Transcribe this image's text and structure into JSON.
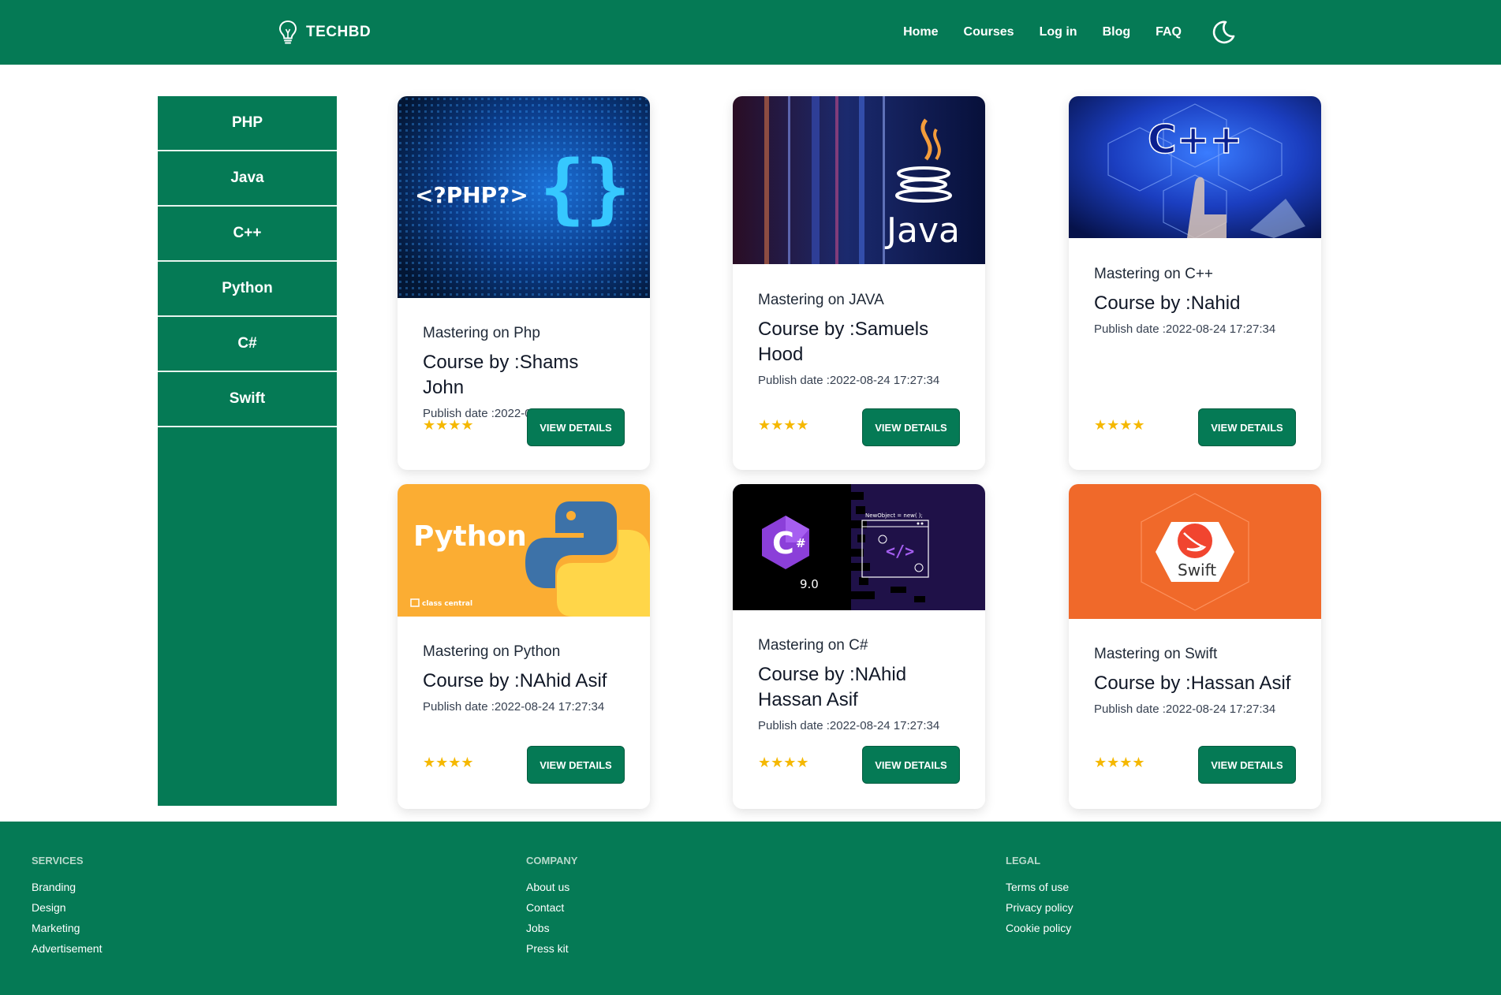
{
  "header": {
    "brand": "TECHBD",
    "nav": [
      "Home",
      "Courses",
      "Log in",
      "Blog",
      "FAQ"
    ]
  },
  "sidebar": {
    "items": [
      {
        "label": "PHP"
      },
      {
        "label": "Java"
      },
      {
        "label": "C++"
      },
      {
        "label": "Python"
      },
      {
        "label": "C#"
      },
      {
        "label": "Swift"
      }
    ]
  },
  "courses": [
    {
      "subtitle": "Mastering on Php",
      "title": "Course by :Shams John",
      "date": "Publish date :2022-08-24 17:27:34",
      "button": "VIEW DETAILS",
      "rating": 4,
      "stars": "★★★★",
      "image_text": "<?PHP?>"
    },
    {
      "subtitle": "Mastering on JAVA",
      "title": "Course by :Samuels Hood",
      "date": "Publish date :2022-08-24 17:27:34",
      "button": "VIEW DETAILS",
      "rating": 4,
      "stars": "★★★★",
      "image_text": "Java"
    },
    {
      "subtitle": "Mastering on C++",
      "title": "Course by :Nahid",
      "date": "Publish date :2022-08-24 17:27:34",
      "button": "VIEW DETAILS",
      "rating": 4,
      "stars": "★★★★",
      "image_text": "C++"
    },
    {
      "subtitle": "Mastering on Python",
      "title": "Course by :NAhid Asif",
      "date": "Publish date :2022-08-24 17:27:34",
      "button": "VIEW DETAILS",
      "rating": 4,
      "stars": "★★★★",
      "image_text": "Python",
      "image_caption": "class central"
    },
    {
      "subtitle": "Mastering on C#",
      "title": "Course by :NAhid Hassan Asif",
      "date": "Publish date :2022-08-24 17:27:34",
      "button": "VIEW DETAILS",
      "rating": 4,
      "stars": "★★★★",
      "image_text": "9.0",
      "image_code": "NewObject = new( );"
    },
    {
      "subtitle": "Mastering on Swift",
      "title": "Course by :Hassan Asif",
      "date": "Publish date :2022-08-24 17:27:34",
      "button": "VIEW DETAILS",
      "rating": 4,
      "stars": "★★★★",
      "image_text": "Swift"
    }
  ],
  "footer": {
    "services": {
      "heading": "SERVICES",
      "links": [
        "Branding",
        "Design",
        "Marketing",
        "Advertisement"
      ]
    },
    "company": {
      "heading": "COMPANY",
      "links": [
        "About us",
        "Contact",
        "Jobs",
        "Press kit"
      ]
    },
    "legal": {
      "heading": "LEGAL",
      "links": [
        "Terms of use",
        "Privacy policy",
        "Cookie policy"
      ]
    }
  },
  "colors": {
    "primary": "#057a55",
    "star": "#f5b800",
    "footer_heading": "#b7d9cb"
  },
  "icons": [
    "lightbulb-icon",
    "moon-icon",
    "star-icon"
  ]
}
